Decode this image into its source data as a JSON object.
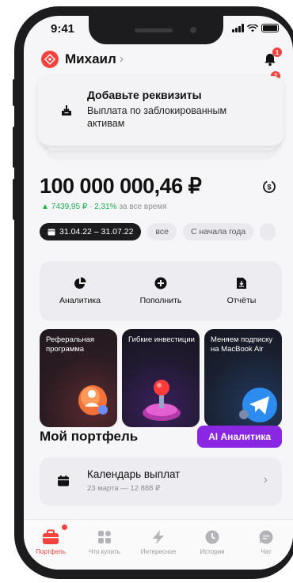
{
  "status_bar": {
    "time": "9:41"
  },
  "header": {
    "username": "Михаил",
    "notification_count": "1",
    "secondary_badge": "7"
  },
  "promo": {
    "title": "Добавьте реквизиты",
    "subtitle": "Выплата по заблокированным активам"
  },
  "balance": {
    "amount": "100 000 000,46 ₽",
    "change": "7439,95 ₽ · 2,31%",
    "change_period": "за все время"
  },
  "filters": [
    {
      "label": "31.04.22 – 31.07.22",
      "active": true
    },
    {
      "label": "все",
      "active": false
    },
    {
      "label": "С начала года",
      "active": false
    }
  ],
  "actions": [
    {
      "label": "Аналитика",
      "icon": "pie-chart-icon"
    },
    {
      "label": "Пополнить",
      "icon": "plus-circle-icon"
    },
    {
      "label": "Отчёты",
      "icon": "document-download-icon"
    }
  ],
  "stories": [
    {
      "text": "Реферальная программа"
    },
    {
      "text": "Гибкие инвестиции"
    },
    {
      "text": "Меняем подписку на MacBook Air"
    }
  ],
  "portfolio": {
    "title": "Мой портфель",
    "ai_button": "AI Аналитика",
    "calendar_title": "Календарь выплат",
    "calendar_sub": "23 марта — 12 888 ₽"
  },
  "tabbar": [
    {
      "label": "Портфель",
      "icon": "briefcase-icon",
      "active": true
    },
    {
      "label": "Что купить",
      "icon": "grid-icon",
      "active": false
    },
    {
      "label": "Интересное",
      "icon": "lightning-icon",
      "active": false
    },
    {
      "label": "История",
      "icon": "clock-icon",
      "active": false
    },
    {
      "label": "Чат",
      "icon": "chat-icon",
      "active": false
    }
  ],
  "colors": {
    "accent_red": "#f2433f",
    "ai_purple": "#8a27e2",
    "gain_green": "#1eae54"
  }
}
